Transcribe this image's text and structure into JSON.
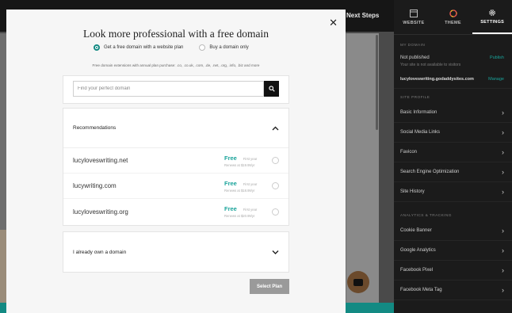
{
  "background": {
    "next_steps_label": "Next Steps"
  },
  "panel": {
    "tabs": [
      {
        "label": "WEBSITE",
        "icon": "layout-icon"
      },
      {
        "label": "THEME",
        "icon": "palette-icon"
      },
      {
        "label": "SETTINGS",
        "icon": "gear-icon"
      }
    ],
    "my_domain_heading": "MY DOMAIN",
    "status": {
      "label": "Not published",
      "sublabel": "Your site is not available to visitors",
      "action": "Publish"
    },
    "domain": {
      "name": "lucyloveswriting.godaddysites.com",
      "action": "Manage"
    },
    "site_profile_heading": "SITE PROFILE",
    "profile_items": [
      "Basic Information",
      "Social Media Links",
      "Favicon",
      "Search Engine Optimization",
      "Site History"
    ],
    "analytics_heading": "ANALYTICS & TRACKING",
    "analytics_items": [
      "Cookie Banner",
      "Google Analytics",
      "Facebook Pixel",
      "Facebook Meta Tag"
    ]
  },
  "modal": {
    "title": "Look more professional with a free domain",
    "option_plan": "Get a free domain with a website plan",
    "option_buy": "Buy a domain only",
    "extensions_note": "Free domain extensions with annual plan purchase: .co, .co.uk, .com, .de, .net, .org, .info, .biz and more",
    "search_placeholder": "Find your perfect domain",
    "recommendations_label": "Recommendations",
    "recommendations": [
      {
        "domain": "lucyloveswriting.net",
        "price": "Free",
        "first_year": "First year",
        "renews": "Renews at $19.99/yr"
      },
      {
        "domain": "lucywriting.com",
        "price": "Free",
        "first_year": "First year",
        "renews": "Renews at $18.99/yr"
      },
      {
        "domain": "lucyloveswriting.org",
        "price": "Free",
        "first_year": "First year",
        "renews": "Renews at $20.99/yr"
      }
    ],
    "own_domain_label": "I already own a domain",
    "select_plan_label": "Select Plan"
  }
}
